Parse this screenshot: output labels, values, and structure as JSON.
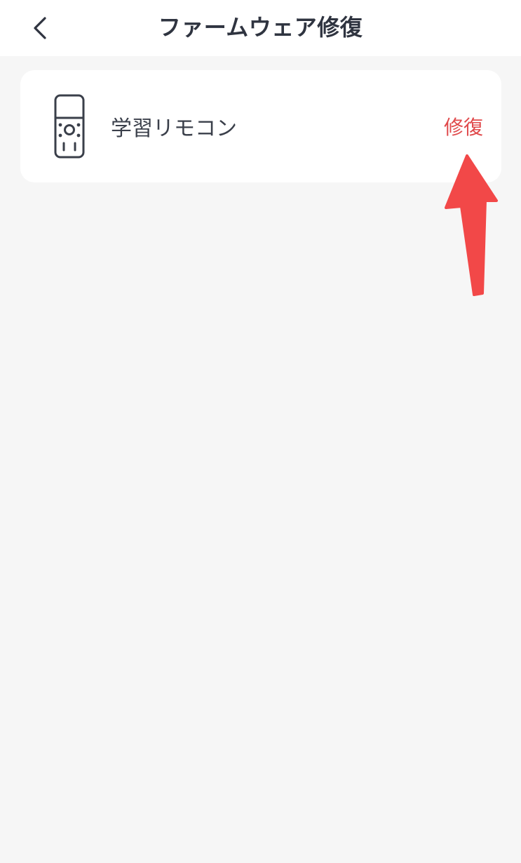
{
  "header": {
    "title": "ファームウェア修復",
    "back_icon": "chevron-left-icon"
  },
  "device_card": {
    "icon": "remote-control-icon",
    "name": "学習リモコン",
    "action_label": "修復"
  },
  "colors": {
    "accent": "#e0494b",
    "arrow": "#f24848",
    "background": "#f6f6f6",
    "text_primary": "#2f3440"
  }
}
